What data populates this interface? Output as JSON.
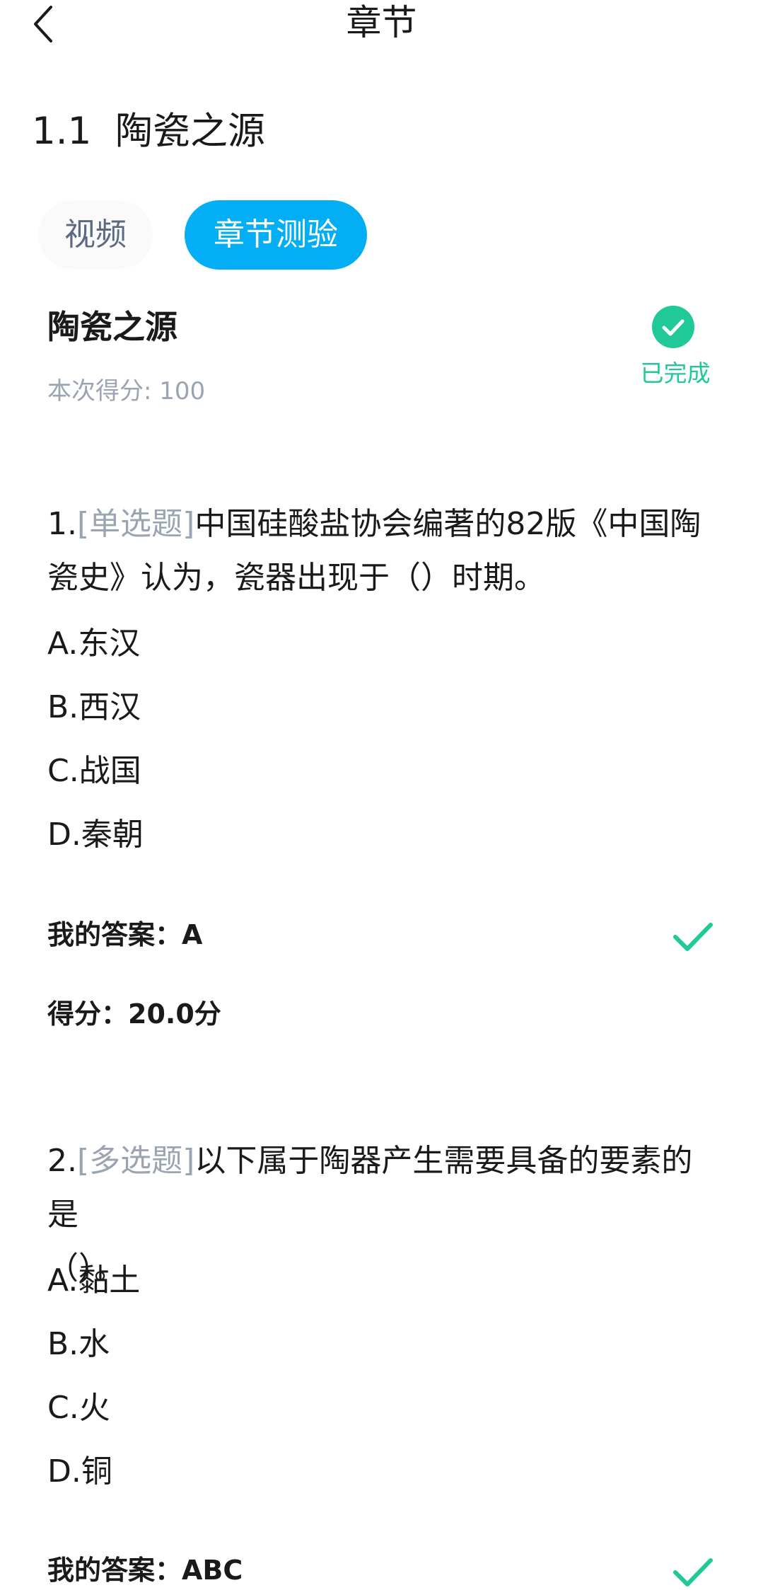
{
  "header": {
    "title": "章节",
    "back_icon": "chevron-left-icon"
  },
  "chapter": {
    "number": "1.1",
    "title": "陶瓷之源"
  },
  "tabs": [
    {
      "label": "视频",
      "active": false
    },
    {
      "label": "章节测验",
      "active": true
    }
  ],
  "quiz": {
    "title": "陶瓷之源",
    "score_text": "本次得分: 100",
    "status": "已完成",
    "status_icon": "check-circle-icon",
    "status_color": "#20c997"
  },
  "colors": {
    "accent": "#03aef4",
    "correct": "#20c997",
    "muted": "#9aa4b2"
  },
  "questions": [
    {
      "number": "1.",
      "type": "[单选题]",
      "line1": "中国硅酸盐协会编著的82版《中国陶",
      "line2": "瓷史》认为，瓷器出现于（）时期。",
      "options": [
        "A.东汉",
        "B.西汉",
        "C.战国",
        "D.秦朝"
      ],
      "my_answer": "我的答案：A",
      "score": "得分：20.0分",
      "result_icon": "check-icon"
    },
    {
      "number": "2.",
      "type": "[多选题]",
      "line1": "以下属于陶器产生需要具备的要素的是",
      "line2": "（）。",
      "options": [
        "A.黏土",
        "B.水",
        "C.火",
        "D.铜"
      ],
      "my_answer": "我的答案：ABC",
      "result_icon": "check-icon"
    }
  ]
}
